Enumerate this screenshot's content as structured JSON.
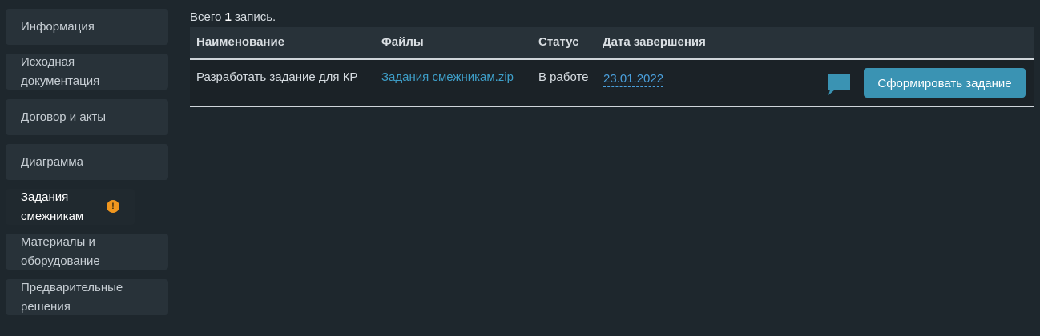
{
  "sidebar": {
    "items": [
      {
        "label": "Информация"
      },
      {
        "label": "Исходная\nдокументация"
      },
      {
        "label": "Договор и акты"
      },
      {
        "label": "Диаграмма"
      },
      {
        "label": "Задания\nсмежникам",
        "active": true,
        "badge": "!"
      },
      {
        "label": "Материалы и\nоборудование"
      },
      {
        "label": "Предварительные\nрешения"
      }
    ]
  },
  "main": {
    "count_prefix": "Всего ",
    "count_value": "1",
    "count_suffix": " запись.",
    "columns": [
      "Наименование",
      "Файлы",
      "Статус",
      "Дата завершения"
    ],
    "rows": [
      {
        "name": "Разработать задание для КР",
        "file": "Задания смежникам.zip",
        "status": "В работе",
        "date": "23.01.2022",
        "action_label": "Сформировать задание"
      }
    ]
  },
  "colors": {
    "background": "#1e272d",
    "accent": "#3a93b3",
    "link": "#3e9fc9",
    "warning": "#f0961e"
  },
  "icons": {
    "comment": "chat-bubble-icon",
    "warning": "exclamation-icon"
  }
}
